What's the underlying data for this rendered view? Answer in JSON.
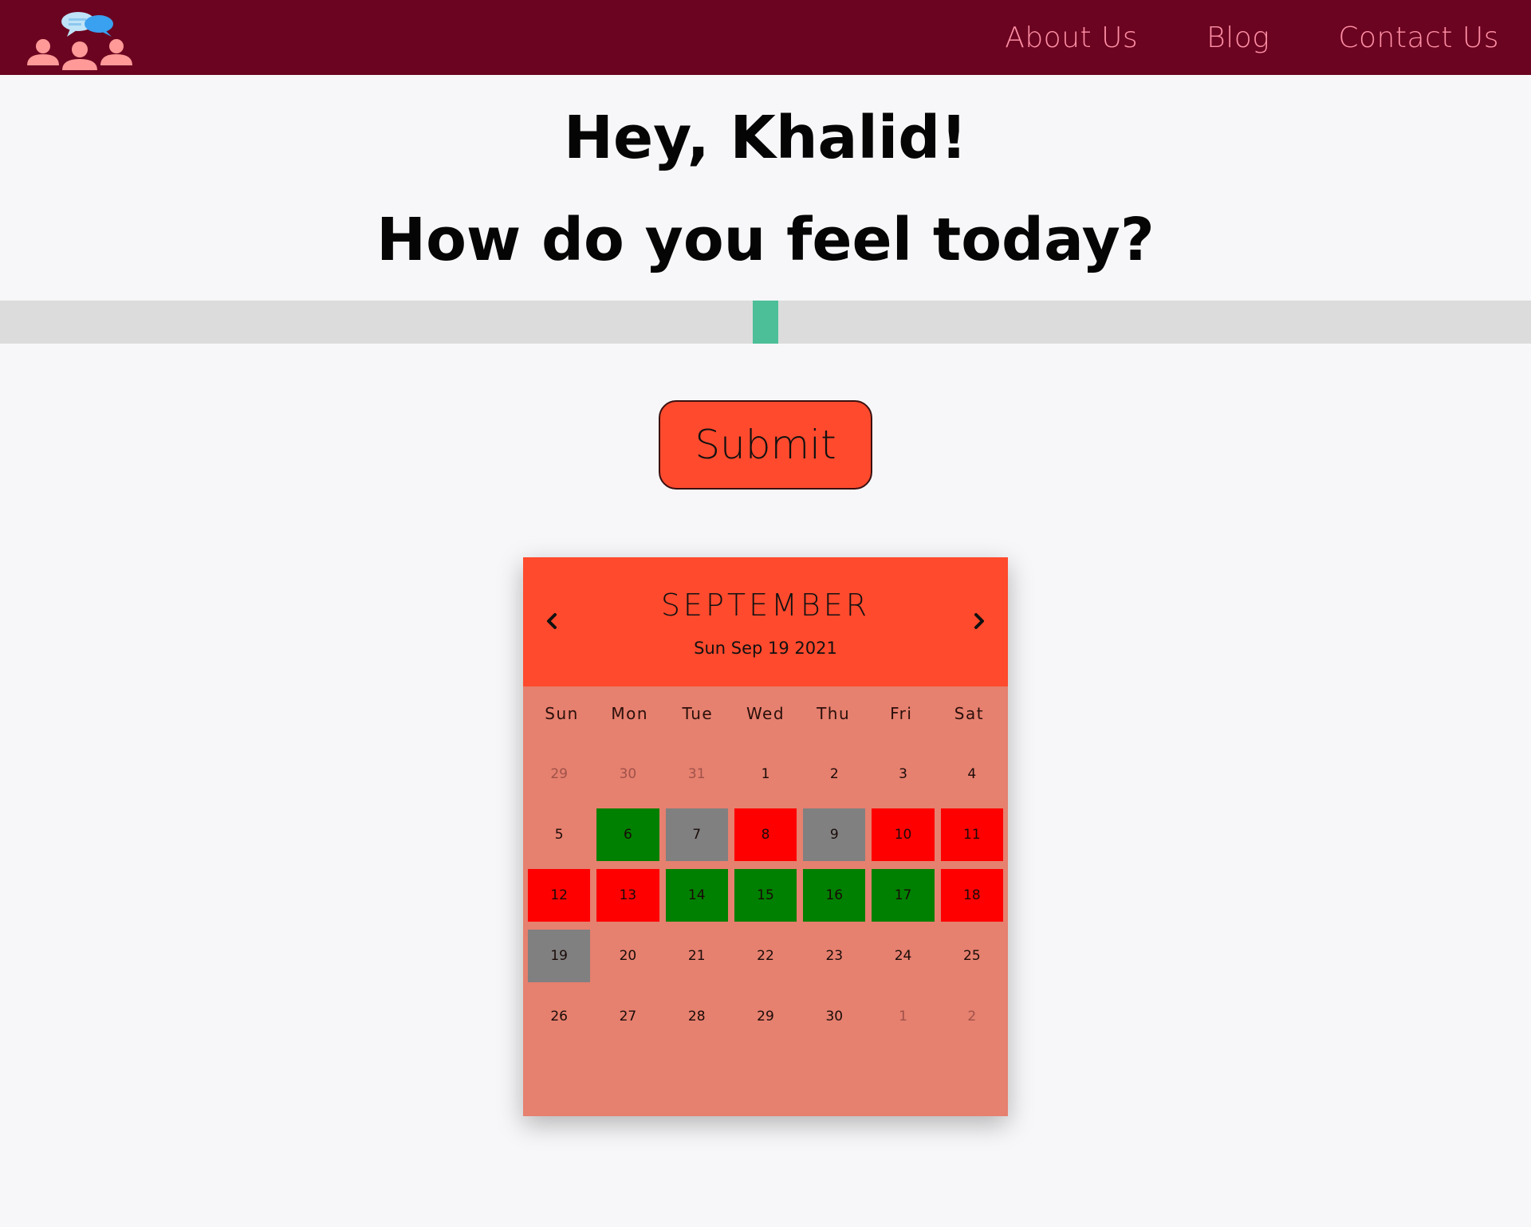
{
  "nav": {
    "links": [
      "About Us",
      "Blog",
      "Contact Us"
    ]
  },
  "greeting": {
    "line1": "Hey, Khalid!",
    "line2": "How do you feel today?"
  },
  "mood_slider": {
    "value": 0.5,
    "track_color": "#dcdcdc",
    "thumb_color": "#4cbf98"
  },
  "submit": {
    "label": "Submit"
  },
  "calendar": {
    "month": "SEPTEMBER",
    "selected_date": "Sun Sep 19 2021",
    "weekdays": [
      "Sun",
      "Mon",
      "Tue",
      "Wed",
      "Thu",
      "Fri",
      "Sat"
    ],
    "days": [
      {
        "label": "29",
        "state": "muted"
      },
      {
        "label": "30",
        "state": "muted"
      },
      {
        "label": "31",
        "state": "muted"
      },
      {
        "label": "1",
        "state": "none"
      },
      {
        "label": "2",
        "state": "none"
      },
      {
        "label": "3",
        "state": "none"
      },
      {
        "label": "4",
        "state": "none"
      },
      {
        "label": "5",
        "state": "none"
      },
      {
        "label": "6",
        "state": "green"
      },
      {
        "label": "7",
        "state": "gray"
      },
      {
        "label": "8",
        "state": "red"
      },
      {
        "label": "9",
        "state": "gray"
      },
      {
        "label": "10",
        "state": "red"
      },
      {
        "label": "11",
        "state": "red"
      },
      {
        "label": "12",
        "state": "red"
      },
      {
        "label": "13",
        "state": "red"
      },
      {
        "label": "14",
        "state": "green"
      },
      {
        "label": "15",
        "state": "green"
      },
      {
        "label": "16",
        "state": "green"
      },
      {
        "label": "17",
        "state": "green"
      },
      {
        "label": "18",
        "state": "red"
      },
      {
        "label": "19",
        "state": "gray"
      },
      {
        "label": "20",
        "state": "none"
      },
      {
        "label": "21",
        "state": "none"
      },
      {
        "label": "22",
        "state": "none"
      },
      {
        "label": "23",
        "state": "none"
      },
      {
        "label": "24",
        "state": "none"
      },
      {
        "label": "25",
        "state": "none"
      },
      {
        "label": "26",
        "state": "none"
      },
      {
        "label": "27",
        "state": "none"
      },
      {
        "label": "28",
        "state": "none"
      },
      {
        "label": "29",
        "state": "none"
      },
      {
        "label": "30",
        "state": "none"
      },
      {
        "label": "1",
        "state": "muted"
      },
      {
        "label": "2",
        "state": "muted"
      }
    ],
    "colors": {
      "header": "#ff4a2d",
      "body": "#e6806f",
      "green": "#008000",
      "gray": "#808080",
      "red": "#ff0000"
    }
  },
  "icons": {
    "logo": "community-chat-logo-icon",
    "prev": "chevron-left-icon",
    "next": "chevron-right-icon"
  }
}
